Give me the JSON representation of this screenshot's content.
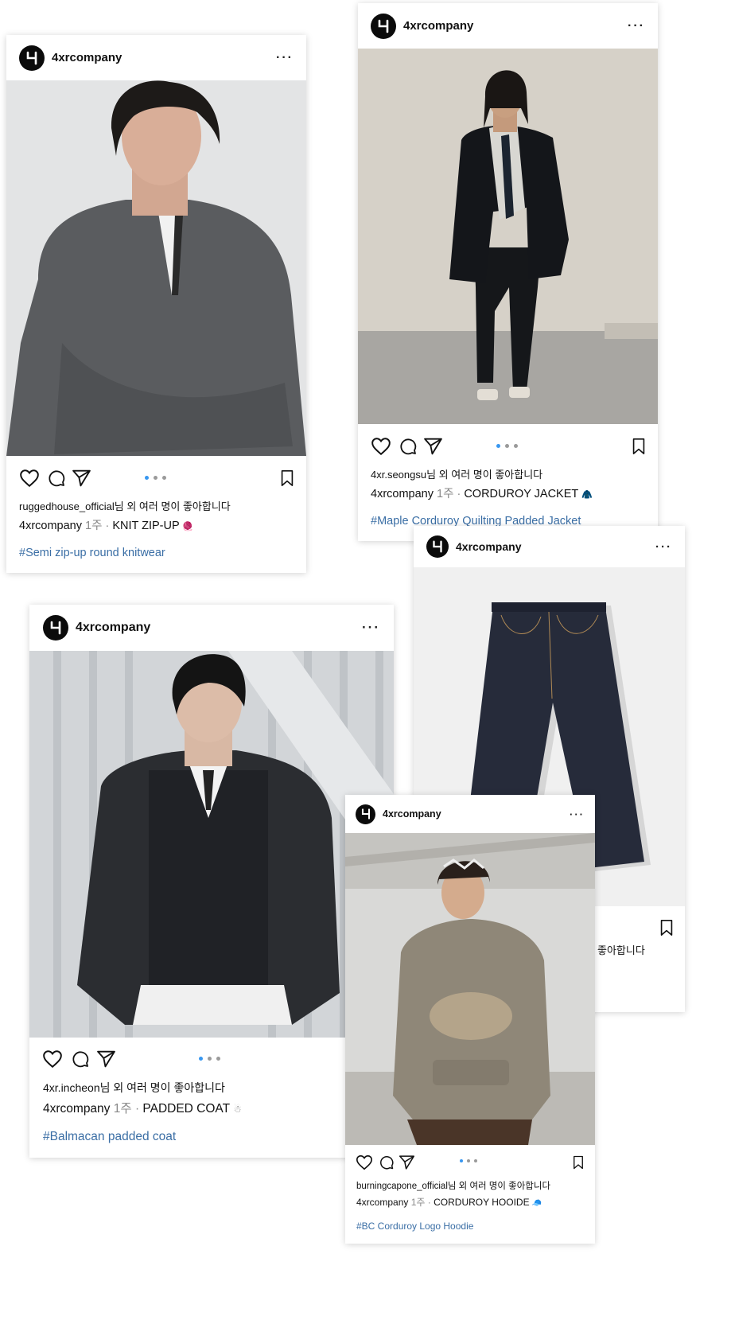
{
  "brand": {
    "username": "4xrcompany",
    "avatar_glyph": "4"
  },
  "posts": [
    {
      "liker": "ruggedhouse_official",
      "likes_suffix": "님 외 여러 명이 좋아합니다",
      "author": "4xrcompany",
      "time": "1주",
      "sep": " · ",
      "caption": "KNIT ZIP-UP",
      "emoji": "🧶",
      "hashtag": "#Semi zip-up round knitwear",
      "more": "···",
      "carousel_index": 1,
      "carousel_total": 3
    },
    {
      "liker": "4xr.seongsu",
      "likes_suffix": "님 외 여러 명이 좋아합니다",
      "author": "4xrcompany",
      "time": "1주",
      "sep": " · ",
      "caption": "CORDUROY JACKET",
      "emoji": "🧥",
      "hashtag": "#Maple Corduroy Quilting Padded Jacket",
      "more": "···",
      "carousel_index": 1,
      "carousel_total": 3
    },
    {
      "likes_partial": "좋아합니다",
      "more": "···"
    },
    {
      "liker": "4xr.incheon",
      "likes_suffix": "님 외 여러 명이 좋아합니다",
      "author": "4xrcompany",
      "time": "1주",
      "sep": " · ",
      "caption": "PADDED COAT",
      "emoji": "☃",
      "hashtag": "#Balmacan padded coat",
      "more": "···",
      "carousel_index": 1,
      "carousel_total": 3
    },
    {
      "liker": "burningcapone_official",
      "likes_suffix": "님 외 여러 명이 좋아합니다",
      "author": "4xrcompany",
      "time": "1주",
      "sep": " · ",
      "caption": "CORDUROY HOOIDE",
      "emoji": "🧢",
      "hashtag": "#BC Corduroy Logo Hoodie",
      "more": "···",
      "carousel_index": 1,
      "carousel_total": 3
    }
  ],
  "icons": [
    "heart-icon",
    "comment-icon",
    "send-icon",
    "bookmark-icon",
    "more-icon"
  ],
  "colors": {
    "accent_dot": "#3897f0",
    "hashtag": "#3a6ea5",
    "avatar_bg": "#0b0b0b"
  }
}
